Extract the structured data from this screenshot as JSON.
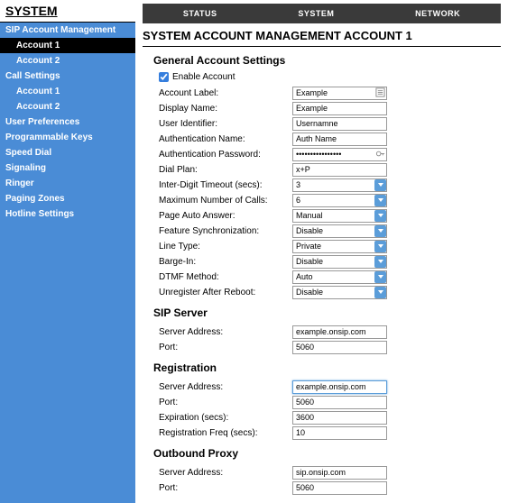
{
  "sidebar": {
    "title": "SYSTEM",
    "items": [
      {
        "label": "SIP Account Management",
        "sub": false,
        "active": false
      },
      {
        "label": "Account 1",
        "sub": true,
        "active": true
      },
      {
        "label": "Account 2",
        "sub": true,
        "active": false
      },
      {
        "label": "Call Settings",
        "sub": false,
        "active": false
      },
      {
        "label": "Account 1",
        "sub": true,
        "active": false
      },
      {
        "label": "Account 2",
        "sub": true,
        "active": false
      },
      {
        "label": "User Preferences",
        "sub": false,
        "active": false
      },
      {
        "label": "Programmable Keys",
        "sub": false,
        "active": false
      },
      {
        "label": "Speed Dial",
        "sub": false,
        "active": false
      },
      {
        "label": "Signaling",
        "sub": false,
        "active": false
      },
      {
        "label": "Ringer",
        "sub": false,
        "active": false
      },
      {
        "label": "Paging Zones",
        "sub": false,
        "active": false
      },
      {
        "label": "Hotline Settings",
        "sub": false,
        "active": false
      }
    ]
  },
  "topnav": {
    "status": "STATUS",
    "system": "SYSTEM",
    "network": "NETWORK"
  },
  "page": {
    "title": "SYSTEM ACCOUNT MANAGEMENT ACCOUNT 1"
  },
  "general": {
    "heading": "General Account Settings",
    "enable_label": "Enable Account",
    "enable_checked": true,
    "account_label_lbl": "Account Label:",
    "account_label_val": "Example",
    "display_name_lbl": "Display Name:",
    "display_name_val": "Example",
    "user_identifier_lbl": "User Identifier:",
    "user_identifier_val": "Usernamne",
    "auth_name_lbl": "Authentication Name:",
    "auth_name_val": "Auth Name",
    "auth_pw_lbl": "Authentication Password:",
    "auth_pw_val": "••••••••••••••••",
    "dial_plan_lbl": "Dial Plan:",
    "dial_plan_val": "x+P",
    "interdigit_lbl": "Inter-Digit Timeout (secs):",
    "interdigit_val": "3",
    "maxcalls_lbl": "Maximum Number of Calls:",
    "maxcalls_val": "6",
    "page_auto_lbl": "Page Auto Answer:",
    "page_auto_val": "Manual",
    "feature_sync_lbl": "Feature Synchronization:",
    "feature_sync_val": "Disable",
    "line_type_lbl": "Line Type:",
    "line_type_val": "Private",
    "barge_in_lbl": "Barge-In:",
    "barge_in_val": "Disable",
    "dtmf_lbl": "DTMF Method:",
    "dtmf_val": "Auto",
    "unreg_lbl": "Unregister After Reboot:",
    "unreg_val": "Disable"
  },
  "sip_server": {
    "heading": "SIP Server",
    "address_lbl": "Server Address:",
    "address_val": "example.onsip.com",
    "port_lbl": "Port:",
    "port_val": "5060"
  },
  "registration": {
    "heading": "Registration",
    "address_lbl": "Server Address:",
    "address_val": "example.onsip.com",
    "port_lbl": "Port:",
    "port_val": "5060",
    "expiration_lbl": "Expiration (secs):",
    "expiration_val": "3600",
    "freq_lbl": "Registration Freq (secs):",
    "freq_val": "10"
  },
  "outbound": {
    "heading": "Outbound Proxy",
    "address_lbl": "Server Address:",
    "address_val": "sip.onsip.com",
    "port_lbl": "Port:",
    "port_val": "5060"
  }
}
